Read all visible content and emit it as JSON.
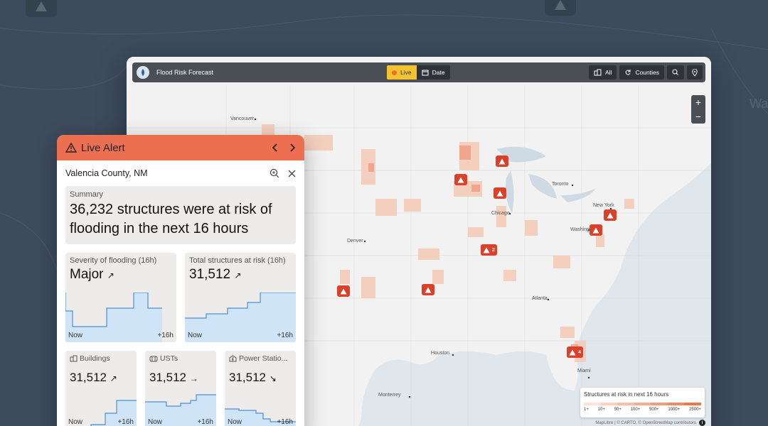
{
  "background": {
    "label_right": "Wa"
  },
  "toolbar": {
    "title": "Flood Risk Forecast",
    "live_label": "Live",
    "date_label": "Date",
    "all_label": "All",
    "counties_label": "Counties"
  },
  "zoom": {
    "in": "+",
    "out": "−"
  },
  "cities": {
    "vancouver": "Vancouver",
    "denver": "Denver",
    "chicago": "Chicago",
    "toronto": "Toronto",
    "newyork": "New York",
    "washington": "Washing",
    "atlanta": "Atlanta",
    "houston": "Houston",
    "miami": "Miami",
    "monterrey": "Monterrey"
  },
  "map_alerts": {
    "a6": "2",
    "a9": "4"
  },
  "legend": {
    "title": "Structures at risk in next 16 hours",
    "ticks": [
      "1+",
      "10+",
      "50+",
      "100+",
      "500+",
      "1000+",
      "2500+"
    ],
    "colors": [
      "#fbe3d8",
      "#f9d2c1",
      "#f6c0aa",
      "#f3ae93",
      "#f09c7c",
      "#ed8a65",
      "#ea784e"
    ]
  },
  "attribution": "MapLibre | © CARTO, © OpenStreetMap contributors",
  "panel": {
    "header_title": "Live Alert",
    "location": "Valencia County, NM",
    "summary_label": "Summary",
    "summary_text": "36,232 structures were at risk of flooding in the next 16 hours",
    "severity": {
      "label": "Severity of flooding (16h)",
      "value": "Major",
      "trend": "↗",
      "now": "Now",
      "end": "+16h"
    },
    "total": {
      "label": "Total structures at risk (16h)",
      "value": "31,512",
      "trend": "↗",
      "now": "Now",
      "end": "+16h"
    },
    "buildings": {
      "label": "Buildings",
      "value": "31,512",
      "trend": "↗",
      "now": "Now",
      "end": "+16h"
    },
    "usts": {
      "label": "USTs",
      "value": "31,512",
      "trend": "→",
      "now": "Now",
      "end": "+16h"
    },
    "power": {
      "label": "Power Statio...",
      "value": "31,512",
      "trend": "↘",
      "now": "Now",
      "end": "+16h"
    }
  },
  "colors": {
    "accent_orange": "#ec6f52",
    "live_yellow": "#f4c430",
    "alert_red": "#d9412b",
    "spark_fill": "#cfe4f7",
    "spark_line": "#4a90d9"
  }
}
